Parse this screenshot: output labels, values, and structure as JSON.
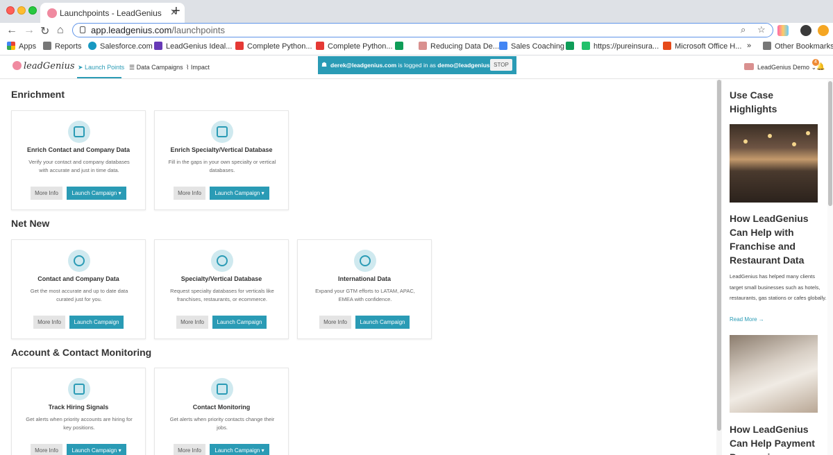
{
  "browser": {
    "tab_title": "Launchpoints - LeadGenius",
    "url_host": "app.leadgenius.com",
    "url_path": "/launchpoints",
    "bookmarks": [
      "Apps",
      "Reports",
      "Salesforce.com",
      "LeadGenius Ideal...",
      "Complete Python...",
      "Complete Python...",
      "Reducing Data De...",
      "Sales Coaching",
      "https://pureinsura...",
      "Microsoft Office H...",
      "»",
      "Other Bookmarks"
    ]
  },
  "app": {
    "logo_text": "leadGenius",
    "nav": [
      "Launch Points",
      "Data Campaigns",
      "Impact"
    ],
    "banner": {
      "user": "derek@leadgenius.com",
      "middle": " is logged in as ",
      "as_user": "demo@leadgenius.com",
      "stop_label": "STOP"
    },
    "account_name": "LeadGenius Demo",
    "notification_count": "4"
  },
  "sections": [
    {
      "title": "Enrichment",
      "cards": [
        {
          "title": "Enrich Contact and Company Data",
          "desc": "Verify your contact and company databases with accurate and just in time data.",
          "more": "More Info",
          "launch": "Launch Campaign ▾"
        },
        {
          "title": "Enrich Specialty/Vertical Database",
          "desc": "Fill in the gaps in your own specialty or vertical databases.",
          "more": "More Info",
          "launch": "Launch Campaign ▾"
        }
      ]
    },
    {
      "title": "Net New",
      "cards": [
        {
          "title": "Contact and Company Data",
          "desc": "Get the most accurate and up to date data curated just for you.",
          "more": "More Info",
          "launch": "Launch Campaign"
        },
        {
          "title": "Specialty/Vertical Database",
          "desc": "Request specialty databases for verticals like franchises, restaurants, or ecommerce.",
          "more": "More Info",
          "launch": "Launch Campaign"
        },
        {
          "title": "International Data",
          "desc": "Expand your GTM efforts to LATAM, APAC, EMEA with confidence.",
          "more": "More Info",
          "launch": "Launch Campaign"
        }
      ]
    },
    {
      "title": "Account & Contact Monitoring",
      "cards": [
        {
          "title": "Track Hiring Signals",
          "desc": "Get alerts when priority accounts are hiring for key positions.",
          "more": "More Info",
          "launch": "Launch Campaign ▾"
        },
        {
          "title": "Contact Monitoring",
          "desc": "Get alerts when priority contacts change their jobs.",
          "more": "More Info",
          "launch": "Launch Campaign ▾"
        }
      ]
    }
  ],
  "sidebar": {
    "heading": "Use Case Highlights",
    "article1_title": "How LeadGenius Can Help with Franchise and Restaurant Data",
    "article1_desc": "LeadGenius has helped many clients target small businesses such as hotels, restaurants, gas stations or cafes globally.",
    "read_more": "Read More →",
    "article2_title": "How LeadGenius Can Help Payment Processing"
  },
  "colors": {
    "accent": "#2a9bb5",
    "banner": "#2a9bb5"
  }
}
